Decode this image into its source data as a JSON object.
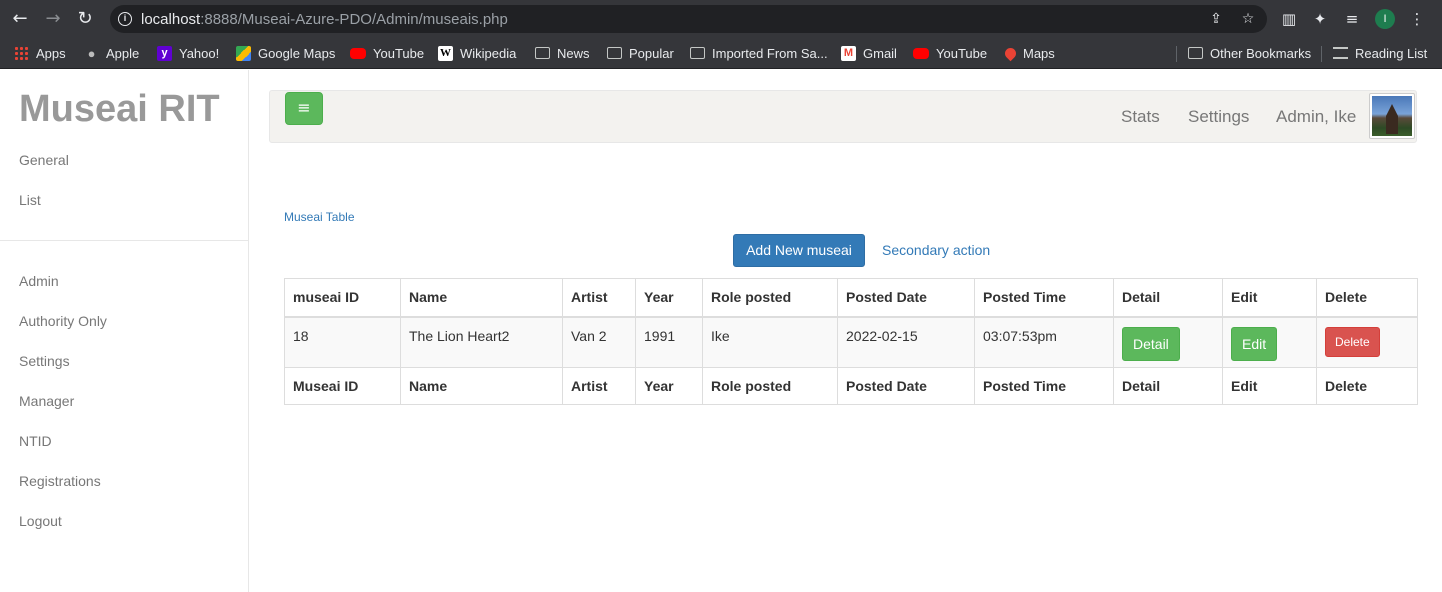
{
  "browser": {
    "url_host": "localhost",
    "url_path": ":8888/Museai-Azure-PDO/Admin/museais.php",
    "profile_initial": "I",
    "bookmarks": [
      {
        "label": "Apps",
        "icon": "apps-grid-icon"
      },
      {
        "label": "Apple",
        "icon": "apple-icon"
      },
      {
        "label": "Yahoo!",
        "icon": "yahoo-icon"
      },
      {
        "label": "Google Maps",
        "icon": "google-maps-icon"
      },
      {
        "label": "YouTube",
        "icon": "youtube-icon"
      },
      {
        "label": "Wikipedia",
        "icon": "wikipedia-icon"
      },
      {
        "label": "News",
        "icon": "folder-icon"
      },
      {
        "label": "Popular",
        "icon": "folder-icon"
      },
      {
        "label": "Imported From Sa...",
        "icon": "folder-icon"
      },
      {
        "label": "Gmail",
        "icon": "gmail-icon"
      },
      {
        "label": "YouTube",
        "icon": "youtube-icon"
      },
      {
        "label": "Maps",
        "icon": "maps-pin-icon"
      }
    ],
    "other_bookmarks": "Other Bookmarks",
    "reading_list": "Reading List"
  },
  "sidebar": {
    "brand": "Museai RIT",
    "top_links": [
      "General",
      "List"
    ],
    "links": [
      "Admin",
      "Authority Only",
      "Settings",
      "Manager",
      "NTID",
      "Registrations",
      "Logout"
    ]
  },
  "topnav": {
    "toggle_icon": "≡",
    "links": [
      "Stats",
      "Settings",
      "Admin, Ike"
    ]
  },
  "main": {
    "breadcrumb": "Museai Table",
    "add_button": "Add New museai",
    "secondary_action": "Secondary action",
    "table": {
      "headers": [
        "museai ID",
        "Name",
        "Artist",
        "Year",
        "Role posted",
        "Posted Date",
        "Posted Time",
        "Detail",
        "Edit",
        "Delete"
      ],
      "rows": [
        {
          "id": "18",
          "name": "The Lion Heart2",
          "artist": "Van 2",
          "year": "1991",
          "role": "Ike",
          "date": "2022-02-15",
          "time": "03:07:53pm",
          "detail": "Detail",
          "edit": "Edit",
          "delete": "Delete"
        }
      ],
      "footers": [
        "Museai ID",
        "Name",
        "Artist",
        "Year",
        "Role posted",
        "Posted Date",
        "Posted Time",
        "Detail",
        "Edit",
        "Delete"
      ]
    }
  },
  "colors": {
    "primary": "#337ab7",
    "success": "#5cb85c",
    "danger": "#d9534f"
  }
}
